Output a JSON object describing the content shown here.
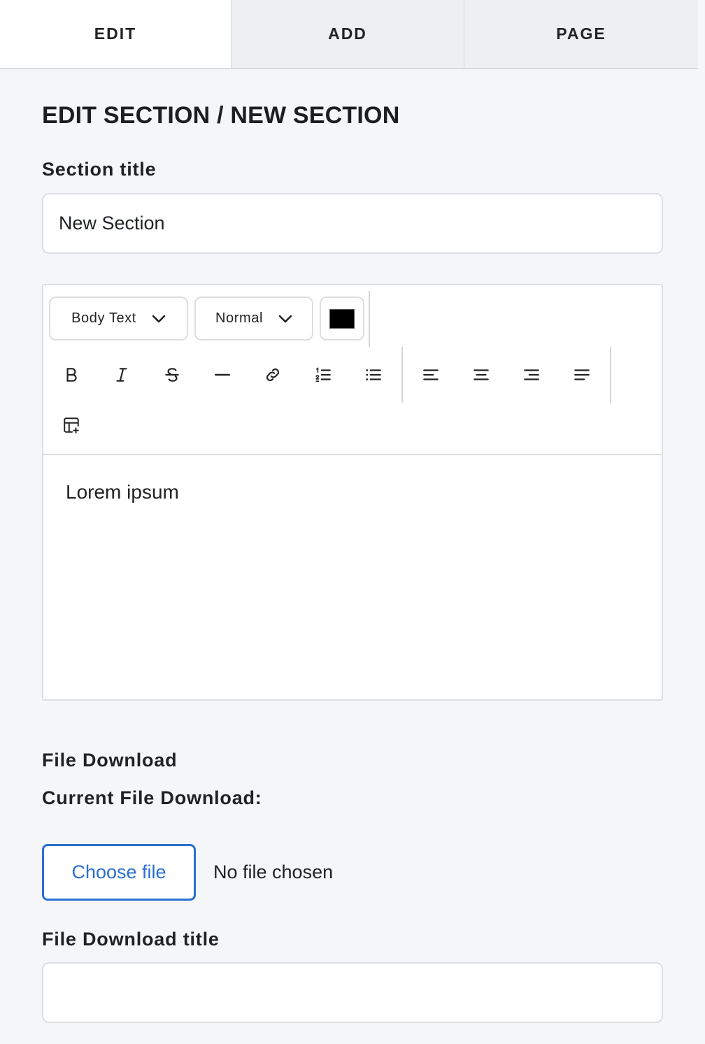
{
  "tabs": [
    {
      "label": "EDIT",
      "active": true
    },
    {
      "label": "ADD",
      "active": false
    },
    {
      "label": "PAGE",
      "active": false
    }
  ],
  "heading": "EDIT SECTION / NEW SECTION",
  "section_title": {
    "label": "Section title",
    "value": "New Section"
  },
  "editor": {
    "style_select": "Body Text",
    "size_select": "Normal",
    "text_color": "#000000",
    "tools": [
      "bold-icon",
      "italic-icon",
      "strikethrough-icon",
      "horizontal-rule-icon",
      "link-icon",
      "ordered-list-icon",
      "bullet-list-icon",
      "align-left-icon",
      "align-center-icon",
      "align-right-icon",
      "align-justify-icon",
      "insert-table-icon"
    ],
    "content": "Lorem ipsum"
  },
  "file_download": {
    "heading": "File Download",
    "current_label": "Current File Download:",
    "choose_button": "Choose file",
    "status": "No file chosen",
    "title_label": "File Download title",
    "title_value": ""
  },
  "colors": {
    "accent": "#2a6fd0",
    "background": "#f5f6f8"
  }
}
